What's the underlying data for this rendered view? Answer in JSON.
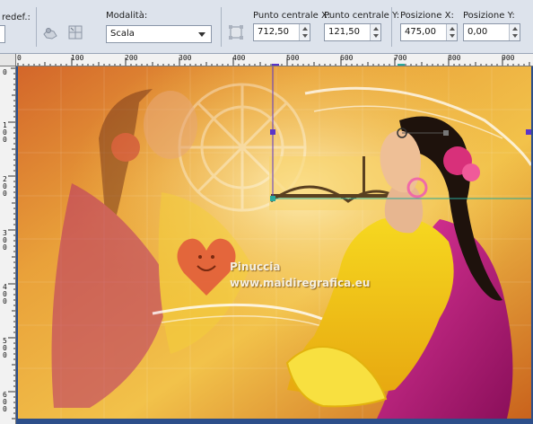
{
  "toolbar": {
    "preset_label": "redef.:",
    "mode_label": "Modalità:",
    "mode_value": "Scala",
    "center_x_label": "Punto centrale X:",
    "center_x_value": "712,50",
    "center_y_label": "Punto centrale Y:",
    "center_y_value": "121,50",
    "pos_x_label": "Posizione X:",
    "pos_x_value": "475,00",
    "pos_y_label": "Posizione Y:",
    "pos_y_value": "0,00",
    "icons": [
      "pick-tool-icon",
      "mesh-icon",
      "transform-icon"
    ]
  },
  "ruler": {
    "h_labels": [
      "0",
      "100",
      "200",
      "300",
      "400",
      "500",
      "600",
      "700",
      "800",
      "900"
    ],
    "v_labels": [
      "0",
      "1 0 0",
      "2 0 0",
      "3 0 0",
      "4 0 0",
      "5 0 0",
      "6 0 0"
    ]
  },
  "canvas": {
    "watermark_name": "Pinuccia",
    "watermark_url": "www.maidiregrafica.eu",
    "colors": {
      "warm_orange": "#e8902a",
      "golden": "#f0c040",
      "magenta": "#c0207a",
      "selection": "#5a35c8",
      "handle_green": "#2aa89a"
    }
  }
}
